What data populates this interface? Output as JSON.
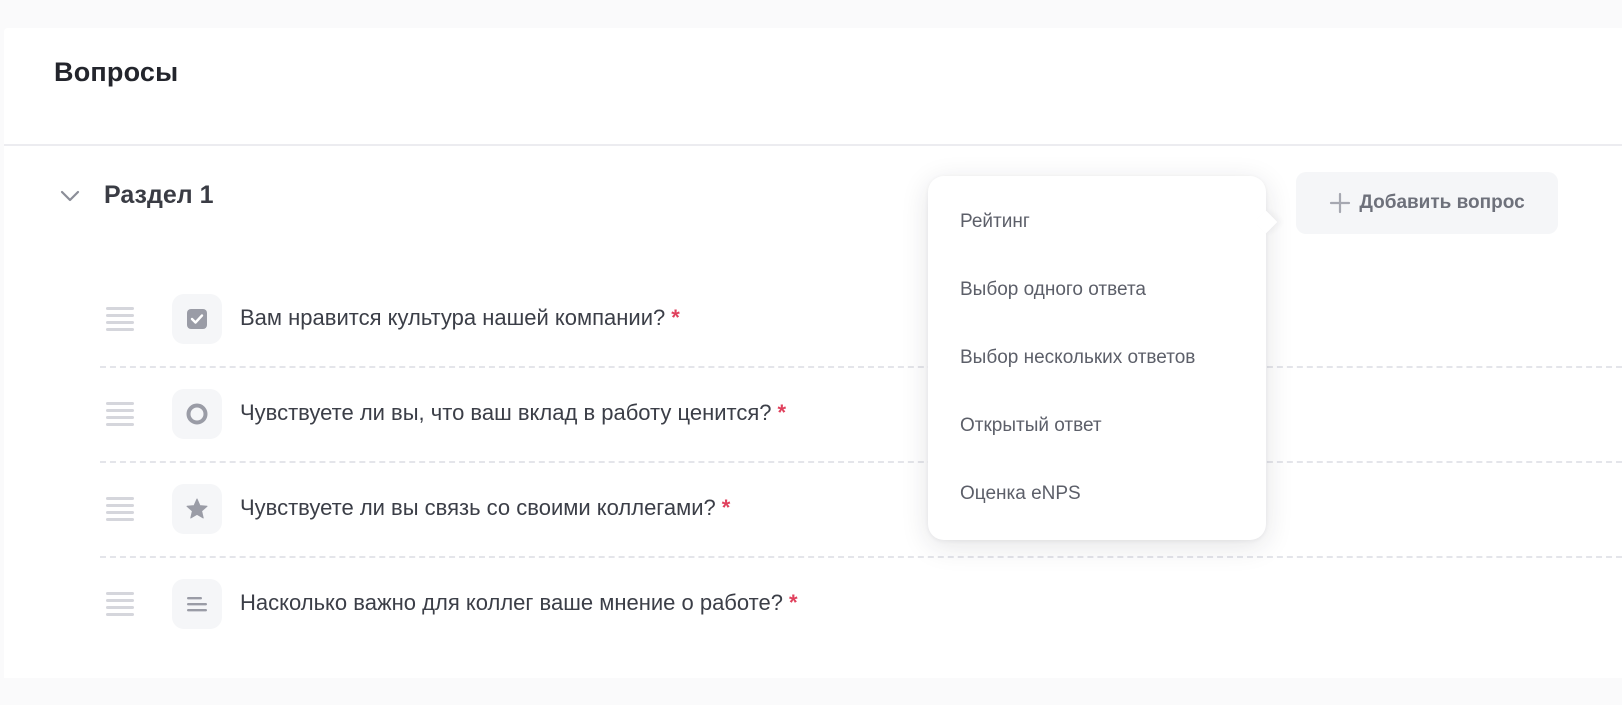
{
  "header": {
    "title": "Вопросы"
  },
  "section": {
    "title": "Раздел 1",
    "add_question_label": "Добавить вопрос"
  },
  "questions": [
    {
      "text": "Вам нравится культура нашей компании?",
      "required_mark": "*",
      "type_icon": "checkbox-icon"
    },
    {
      "text": "Чувствуете ли вы, что ваш вклад в работу ценится?",
      "required_mark": "*",
      "type_icon": "radio-icon"
    },
    {
      "text": "Чувствуете ли вы связь со своими коллегами?",
      "required_mark": "*",
      "type_icon": "star-icon"
    },
    {
      "text": "Насколько важно для коллег ваше мнение о работе?",
      "required_mark": "*",
      "type_icon": "text-lines-icon"
    }
  ],
  "question_type_menu": {
    "items": [
      "Рейтинг",
      "Выбор одного ответа",
      "Выбор нескольких ответов",
      "Открытый ответ",
      "Оценка eNPS"
    ]
  },
  "colors": {
    "required": "#e0415d",
    "text_primary": "#23252c",
    "text_secondary": "#5c5f69",
    "icon_gray": "#9a9ca6",
    "button_bg": "#f5f6f8"
  }
}
